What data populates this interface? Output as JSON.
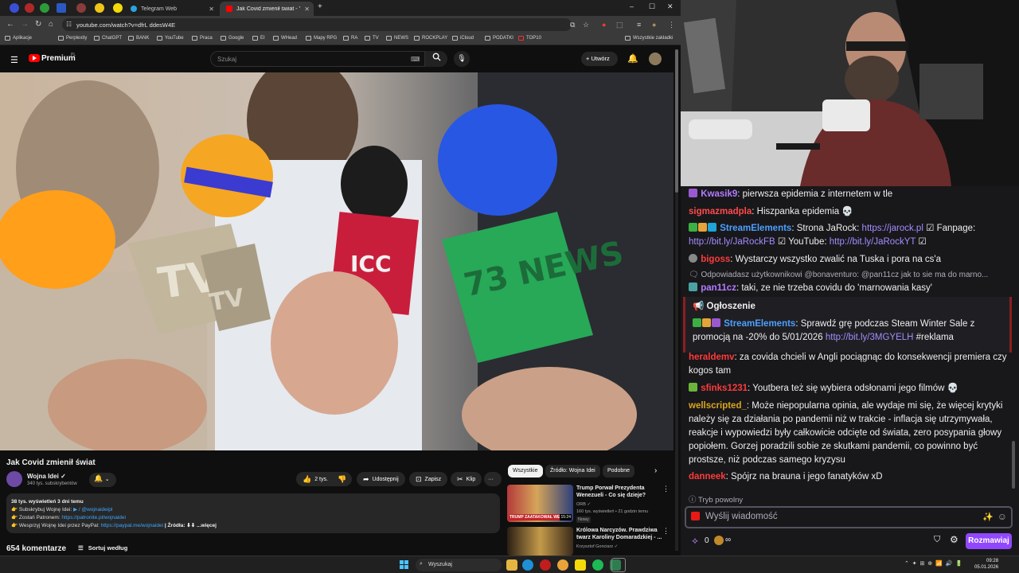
{
  "browser": {
    "tabs": [
      {
        "label": "Telegram Web"
      },
      {
        "label": "Jak Covid zmienił świat - Yo"
      }
    ],
    "new_tab": "+",
    "url": "youtube.com/watch?v=dfrL ddesW4E",
    "window_controls": {
      "minimize": "–",
      "maximize": "☐",
      "close": "✕"
    },
    "bookmarks": [
      "Aplikacje",
      "Perplexity",
      "ChatGPT",
      "BANK",
      "YouTube",
      "Praca",
      "Google",
      "EI",
      "WHead",
      "Mapy RPG",
      "RA",
      "TV",
      "NEWS",
      "ROCKPLAY",
      "iCloud",
      "PODATKI",
      "TOP10"
    ],
    "bookmarks_right": "Wszystkie zakładki"
  },
  "youtube": {
    "brand": "Premium",
    "brand_country": "PL",
    "search_placeholder": "Szukaj",
    "create_label": "Utwórz",
    "video": {
      "title": "Jak Covid zmienił świat",
      "mic_labels": [
        "TV",
        "TV",
        "ICC",
        "73 NEWS"
      ]
    },
    "channel": {
      "name": "Wojna Idei ✓",
      "subscribers": "340 tys. subskrybentów"
    },
    "actions": {
      "likes": "2 tys.",
      "share": "Udostępnij",
      "save": "Zapisz",
      "clip": "Klip",
      "more": "···"
    },
    "description": {
      "stats": "38 tys. wyświetleń  3 dni temu",
      "line1_label": "👉 Subskrybuj Wojnę Idei: ",
      "line1_link": "▶ / @wojnaideipl",
      "line2_label": "👉 Zostań Patronem: ",
      "line2_link": "https://patronite.pl/wojnaidei",
      "line3_label": "👉 Wesprzyj Wojnę Idei przez PayPal: ",
      "line3_link": "https://paypal.me/wojnaidei",
      "line3_tail": "  |  Źródła: ⬇⬇  ...więcej"
    },
    "comments": {
      "count": "654 komentarze",
      "sort": "Sortuj według"
    },
    "chips": [
      "Wszystkie",
      "Źródło: Wojna Idei",
      "Podobne"
    ],
    "recommendations": [
      {
        "title": "Trump Porwał Prezydenta Wenezueli - Co się dzieje?",
        "channel": "ORB ✓",
        "meta": "160 tys. wyświetleń • 21 godzin temu",
        "badge": "Nowy",
        "thumb_text": "TRUMP ZAATAKOWAŁ WEN",
        "duration": "15:24"
      },
      {
        "title": "Królowa Narcyzów. Prawdziwa twarz Karoliny Domaradzkiej - ...",
        "channel": "Krzysztof Gonciarz ✓",
        "meta": "",
        "badge": "",
        "thumb_text": "",
        "duration": ""
      }
    ]
  },
  "chat": {
    "messages": [
      {
        "user": "Kwasik9",
        "color": "#b57bff",
        "text": ": pierwsza epidemia z internetem w tle"
      },
      {
        "user": "sigmazmadpla",
        "color": "#ff4a4a",
        "text": ": Hiszpanka epidemia 💀"
      },
      {
        "user": "StreamElements",
        "color": "#4e9fff",
        "text": ": Strona JaRock: ",
        "link1": "https://jarock.pl",
        "mid": " ☑ Fanpage:",
        "link2": "http://bit.ly/JaRockFB",
        "mid2": " ☑ YouTube: ",
        "link3": "http://bit.ly/JaRockYT",
        "tail": " ☑"
      },
      {
        "user": "bigoss",
        "color": "#ff3b3b",
        "text": ": Wystarczy wszystko zwalić na Tuska i pora na cs'a"
      },
      {
        "reply": "Odpowiadasz użytkownikowi @bonaventuro: @pan11cz jak to sie ma do marno..."
      },
      {
        "user": "pan11cz",
        "color": "#b57bff",
        "text": ": taki, ze nie trzeba covidu do 'marnowania kasy'"
      },
      {
        "announce_title": "Ogłoszenie"
      },
      {
        "user": "StreamElements",
        "color": "#4e9fff",
        "text": ": Sprawdź grę podczas Steam Winter Sale z promocją na -20% do 5/01/2026 ",
        "link1": "http://bit.ly/3MGYELH",
        "tail": " #reklama"
      },
      {
        "user": "heraldemv",
        "color": "#ff3b3b",
        "text": ": za covida chcieli w Angli pociągnąc do konsekwencji premiera czy kogos tam"
      },
      {
        "user": "sfinks1231",
        "color": "#ff3b3b",
        "text": ": Youtbera też się wybiera odsłonami jego filmów 💀"
      },
      {
        "user": "wellscripted_",
        "color": "#daa520",
        "text": ": Może niepopularna opinia, ale wydaje mi się, że więcej krytyki należy się za działania po pandemii niż w trakcie - inflacja się utrzymywała, reakcje i wypowiedzi były całkowicie odcięte od świata, zero posypania głowy popiołem. Gorzej poradzili sobie ze skutkami pandemii, co powinno być prostsze, niż podczas samego kryzysu"
      },
      {
        "user": "danneek",
        "color": "#ff3b3b",
        "text": ": Spójrz na brauna i jego fanatyków xD"
      }
    ],
    "slow_mode": "Tryb powolny",
    "input_placeholder": "Wyślij wiadomość",
    "points": "0",
    "points_infinite": "∞",
    "send_label": "Rozmawiaj"
  },
  "taskbar": {
    "search_label": "Wyszukaj",
    "time": "09:28",
    "date": "05.01.2026"
  },
  "colors": {
    "yt_red": "#ff0000",
    "twitch_purple": "#9147ff",
    "link_blue": "#3ea6ff"
  }
}
